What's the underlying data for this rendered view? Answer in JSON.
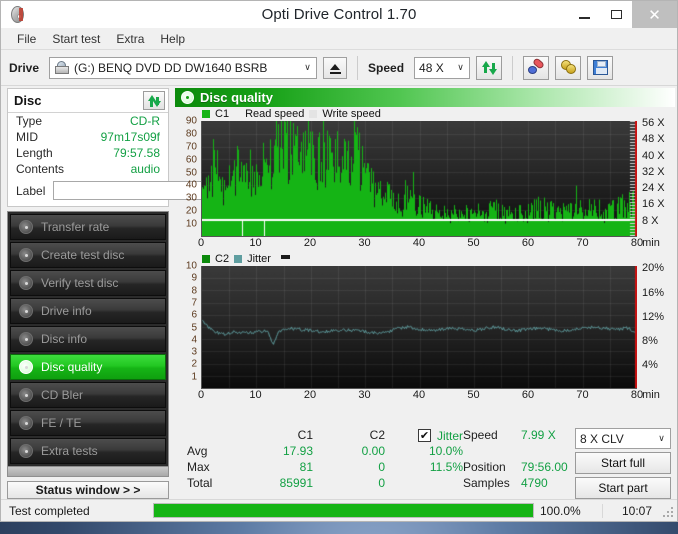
{
  "window": {
    "title": "Opti Drive Control 1.70",
    "app_icon": "cd-disc-icon",
    "controls": {
      "minimize": "–",
      "maximize": "□",
      "close": "✕"
    }
  },
  "menubar": {
    "items": [
      "File",
      "Start test",
      "Extra",
      "Help"
    ]
  },
  "toolbar": {
    "drive_label": "Drive",
    "drive_value": "(G:)   BENQ DVD DD DW1640 BSRB",
    "eject_icon": "eject-icon",
    "speed_label": "Speed",
    "speed_value": "48 X",
    "refresh_icon": "refresh-icon",
    "pill_icon": "pill-icon",
    "coin_icon": "coins-icon",
    "save_icon": "floppy-save-icon"
  },
  "disc_panel": {
    "title": "Disc",
    "refresh_icon": "refresh-icon",
    "rows": [
      {
        "key": "Type",
        "value": "CD-R"
      },
      {
        "key": "MID",
        "value": "97m17s09f"
      },
      {
        "key": "Length",
        "value": "79:57.58"
      },
      {
        "key": "Contents",
        "value": "audio"
      }
    ],
    "label_key": "Label",
    "label_value": "",
    "label_placeholder": "",
    "label_button_icon": "cd-disc-icon"
  },
  "nav": {
    "items": [
      {
        "label": "Transfer rate",
        "active": false
      },
      {
        "label": "Create test disc",
        "active": false
      },
      {
        "label": "Verify test disc",
        "active": false
      },
      {
        "label": "Drive info",
        "active": false
      },
      {
        "label": "Disc info",
        "active": false
      },
      {
        "label": "Disc quality",
        "active": true
      },
      {
        "label": "CD Bler",
        "active": false
      },
      {
        "label": "FE / TE",
        "active": false
      },
      {
        "label": "Extra tests",
        "active": false
      }
    ],
    "status_window_button": "Status window > >"
  },
  "content_header": {
    "title": "Disc quality",
    "icon": "disc-quality-icon"
  },
  "stats": {
    "columns": [
      "C1",
      "C2"
    ],
    "jitter_label": "Jitter",
    "jitter_checked": true,
    "rows": [
      {
        "label": "Avg",
        "c1": "17.93",
        "c2": "0.00",
        "jitter": "10.0%"
      },
      {
        "label": "Max",
        "c1": "81",
        "c2": "0",
        "jitter": "11.5%"
      },
      {
        "label": "Total",
        "c1": "85991",
        "c2": "0",
        "jitter": ""
      }
    ],
    "speed_label": "Speed",
    "speed_value": "7.99 X",
    "position_label": "Position",
    "position_value": "79:56.00",
    "samples_label": "Samples",
    "samples_value": "4790",
    "clv_value": "8 X CLV",
    "start_full": "Start full",
    "start_part": "Start part"
  },
  "statusbar": {
    "text": "Test completed",
    "progress_pct": "100.0%",
    "progress_value": 100,
    "clock": "10:07"
  },
  "colors": {
    "accent_green": "#15b415",
    "value_green": "#13a044",
    "jitter_teal": "#5f9ea0",
    "plot_bg": "#1b1b1b",
    "nav_dark": "#2b2b2b",
    "title_bg": "#ffffff"
  },
  "chart_data": [
    {
      "type": "area",
      "name": "c1-read-speed-chart",
      "title": "C1 / Read speed",
      "legend": [
        {
          "label": "C1",
          "color": "#15b415"
        },
        {
          "label": "Read speed",
          "color": "#ffffff"
        },
        {
          "label": "Write speed",
          "color": "#dcdcdc"
        }
      ],
      "xlabel": "min",
      "xlim": [
        0,
        80
      ],
      "xticks": [
        0,
        10,
        20,
        30,
        40,
        50,
        60,
        70,
        80
      ],
      "ylabel": "",
      "ylim": [
        0,
        90
      ],
      "yticks": [
        10,
        20,
        30,
        40,
        50,
        60,
        70,
        80,
        90
      ],
      "y2label": "X",
      "y2lim": [
        0,
        56
      ],
      "y2ticks": [
        "8 X",
        "16 X",
        "24 X",
        "32 X",
        "40 X",
        "48 X",
        "56 X"
      ],
      "grid": true,
      "series": [
        {
          "name": "C1",
          "color": "#15b415",
          "x": [
            0,
            1,
            2,
            3,
            4,
            5,
            6,
            7,
            8,
            9,
            10,
            11,
            12,
            13,
            14,
            15,
            16,
            17,
            18,
            19,
            20,
            21,
            22,
            23,
            24,
            25,
            26,
            27,
            28,
            29,
            30,
            31,
            32,
            33,
            34,
            35,
            36,
            37,
            38,
            39,
            40,
            42,
            44,
            46,
            48,
            50,
            52,
            54,
            56,
            58,
            60,
            62,
            64,
            66,
            68,
            70,
            72,
            74,
            76,
            78,
            80
          ],
          "values": [
            30,
            42,
            55,
            47,
            38,
            52,
            46,
            61,
            54,
            49,
            58,
            66,
            57,
            63,
            72,
            80,
            68,
            74,
            62,
            70,
            66,
            58,
            72,
            63,
            55,
            68,
            60,
            52,
            74,
            58,
            46,
            40,
            33,
            30,
            36,
            28,
            22,
            20,
            18,
            15,
            14,
            13,
            12,
            11,
            10,
            12,
            11,
            13,
            10,
            12,
            11,
            14,
            12,
            11,
            13,
            12,
            14,
            11,
            13,
            15,
            18
          ]
        },
        {
          "name": "Read speed",
          "color": "#ffffff",
          "x": [
            0,
            10,
            20,
            30,
            40,
            50,
            60,
            70,
            80
          ],
          "values_x": [
            8.0,
            8.0,
            8.0,
            8.0,
            8.0,
            8.0,
            8.0,
            8.0,
            8.0
          ]
        },
        {
          "name": "Write speed",
          "color": "#dcdcdc",
          "x": [],
          "values": []
        }
      ]
    },
    {
      "type": "line",
      "name": "c2-jitter-chart",
      "title": "C2 / Jitter",
      "legend": [
        {
          "label": "C2",
          "color": "#0c8a0c"
        },
        {
          "label": "Jitter",
          "color": "#5f9ea0"
        }
      ],
      "xlabel": "min",
      "xlim": [
        0,
        80
      ],
      "xticks": [
        0,
        10,
        20,
        30,
        40,
        50,
        60,
        70,
        80
      ],
      "ylim": [
        0,
        10
      ],
      "yticks": [
        1,
        2,
        3,
        4,
        5,
        6,
        7,
        8,
        9,
        10
      ],
      "y2lim": [
        0,
        20
      ],
      "y2ticks": [
        "4%",
        "8%",
        "12%",
        "16%",
        "20%"
      ],
      "grid": true,
      "series": [
        {
          "name": "Jitter",
          "color": "#5f9ea0",
          "x": [
            0,
            2,
            4,
            6,
            8,
            10,
            12,
            13,
            14,
            16,
            18,
            20,
            22,
            24,
            26,
            28,
            30,
            32,
            34,
            36,
            38,
            40,
            42,
            44,
            46,
            48,
            50,
            52,
            54,
            56,
            58,
            60,
            62,
            64,
            66,
            68,
            70,
            72,
            74,
            76,
            78,
            80
          ],
          "values": [
            5.5,
            4.6,
            4.4,
            4.6,
            4.5,
            4.6,
            4.7,
            3.6,
            4.6,
            4.9,
            4.8,
            4.7,
            4.6,
            4.7,
            4.8,
            4.7,
            4.6,
            4.5,
            4.6,
            4.9,
            5.0,
            4.8,
            4.7,
            4.8,
            4.9,
            4.8,
            4.7,
            4.9,
            5.0,
            4.8,
            4.7,
            4.8,
            4.9,
            4.8,
            4.7,
            4.8,
            4.9,
            5.0,
            4.9,
            4.8,
            4.9,
            4.6
          ]
        },
        {
          "name": "C2",
          "color": "#0c8a0c",
          "x": [],
          "values": []
        }
      ]
    }
  ]
}
